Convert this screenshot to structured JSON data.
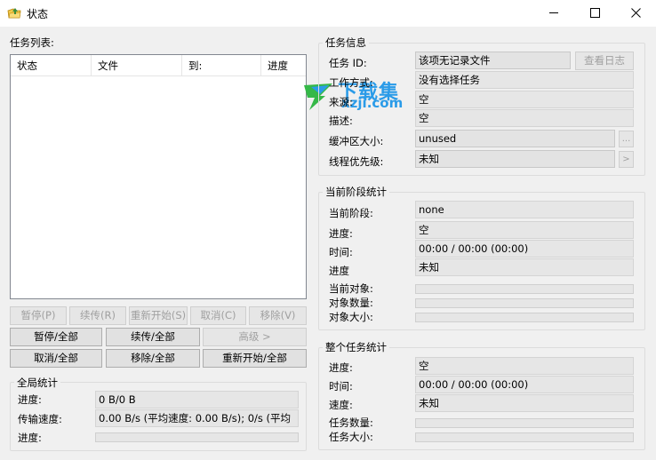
{
  "window": {
    "title": "状态",
    "minimize_icon": "minimize-icon",
    "maximize_icon": "maximize-icon",
    "close_icon": "close-icon"
  },
  "task_list": {
    "label": "任务列表:",
    "columns": [
      "状态",
      "文件",
      "到:",
      "进度"
    ]
  },
  "task_buttons": {
    "pause": "暂停(P)",
    "resume": "续传(R)",
    "restart": "重新开始(S)",
    "cancel": "取消(C)",
    "remove": "移除(V)",
    "pause_all": "暂停/全部",
    "resume_all": "续传/全部",
    "advanced": "高级 >",
    "cancel_all": "取消/全部",
    "remove_all": "移除/全部",
    "restart_all": "重新开始/全部"
  },
  "global_stats": {
    "title": "全局统计",
    "progress_label": "进度:",
    "progress_value": "0 B/0 B",
    "speed_label": "传输速度:",
    "speed_value": "0.00 B/s (平均速度:   0.00 B/s); 0/s (平均",
    "bar_label": "进度:",
    "bar_fraction": 0
  },
  "task_info": {
    "title": "任务信息",
    "id_label": "任务 ID:",
    "id_value": "该项无记录文件",
    "view_log": "查看日志",
    "mode_label": "工作方式:",
    "mode_value": "没有选择任务",
    "source_label": "来源:",
    "source_value": "空",
    "desc_label": "描述:",
    "desc_value": "空",
    "buffer_label": "缓冲区大小:",
    "buffer_value": "unused",
    "buffer_btn": "...",
    "thread_label": "线程优先级:",
    "thread_value": "未知",
    "thread_btn": ">"
  },
  "stage_stats": {
    "title": "当前阶段统计",
    "stage_label": "当前阶段:",
    "stage_value": "none",
    "progress_label": "进度:",
    "progress_value": "空",
    "time_label": "时间:",
    "time_value": "00:00 / 00:00 (00:00)",
    "speed_label": "进度",
    "speed_value": "未知",
    "object_label": "当前对象:",
    "count_label": "对象数量:",
    "size_label": "对象大小:"
  },
  "whole_stats": {
    "title": "整个任务统计",
    "progress_label": "进度:",
    "progress_value": "空",
    "time_label": "时间:",
    "time_value": "00:00 / 00:00 (00:00)",
    "speed_label": "速度:",
    "speed_value": "未知",
    "count_label": "任务数量:",
    "size_label": "任务大小:"
  },
  "watermark": {
    "brand": "下载集",
    "domain": "xzji.com"
  }
}
